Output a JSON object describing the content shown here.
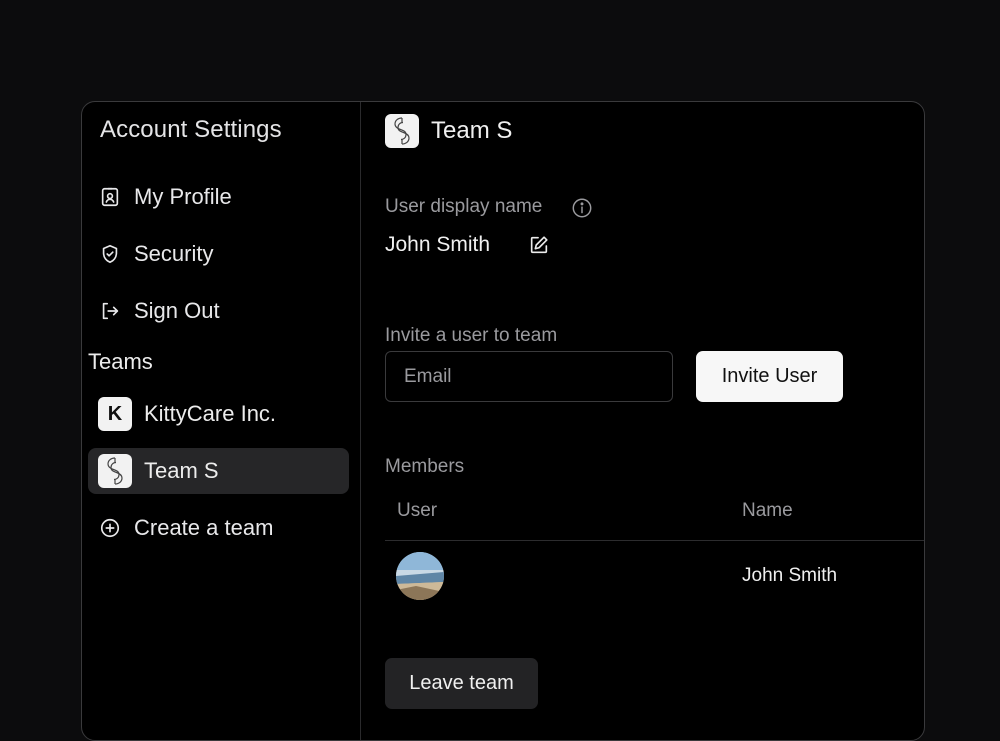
{
  "sidebar": {
    "title": "Account Settings",
    "nav": [
      {
        "label": "My Profile",
        "icon": "profile-badge-icon"
      },
      {
        "label": "Security",
        "icon": "shield-check-icon"
      },
      {
        "label": "Sign Out",
        "icon": "sign-out-icon"
      }
    ],
    "teams_label": "Teams",
    "teams": [
      {
        "label": "KittyCare Inc.",
        "initial": "K",
        "active": false
      },
      {
        "label": "Team S",
        "initial": "S",
        "active": true
      }
    ],
    "create_team_label": "Create a team"
  },
  "main": {
    "team_name": "Team S",
    "display_name_label": "User display name",
    "display_name_value": "John Smith",
    "invite_label": "Invite a user to team",
    "email_placeholder": "Email",
    "invite_button": "Invite User",
    "members_label": "Members",
    "columns": [
      "User",
      "Name"
    ],
    "members": [
      {
        "name": "John Smith"
      }
    ],
    "leave_button": "Leave team"
  },
  "colors": {
    "background": "#0c0c0d",
    "panel": "#000000",
    "active_item": "#262628",
    "muted_text": "#9a9a9e",
    "primary_button": "#f7f7f7",
    "secondary_button": "#232325"
  }
}
